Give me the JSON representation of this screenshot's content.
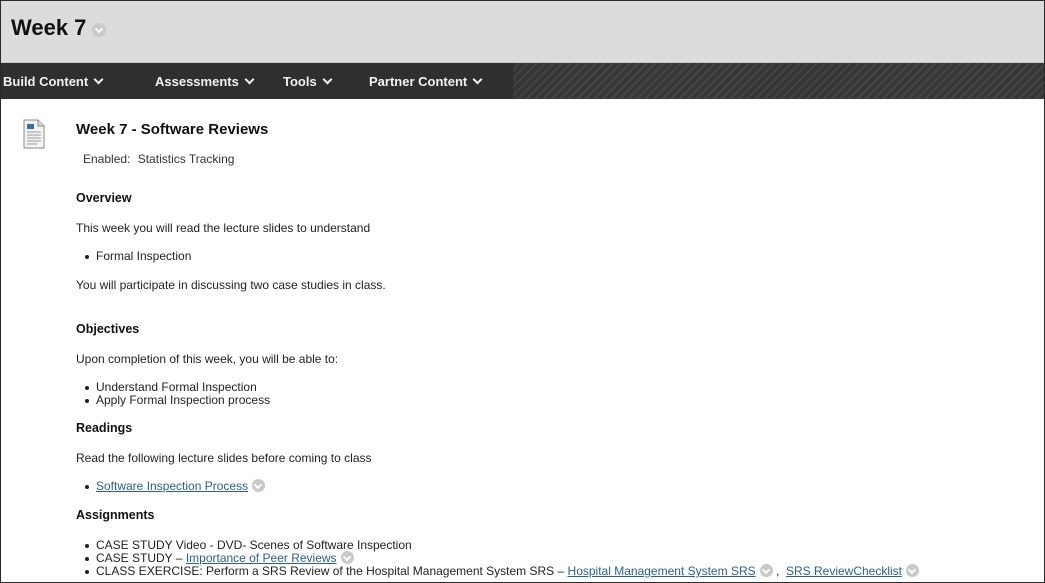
{
  "page": {
    "title": "Week 7"
  },
  "action_bar": {
    "menus": [
      {
        "label": "Build Content"
      },
      {
        "label": "Assessments"
      },
      {
        "label": "Tools"
      },
      {
        "label": "Partner Content"
      }
    ]
  },
  "content_item": {
    "title": "Week 7 - Software Reviews",
    "enabled_label": "Enabled:",
    "enabled_value": "Statistics Tracking",
    "overview": {
      "heading": "Overview",
      "intro": "This week you will read the lecture slides to understand",
      "bullets": [
        "Formal Inspection"
      ],
      "outro": "You will participate in discussing two case studies in class."
    },
    "objectives": {
      "heading": "Objectives",
      "intro": "Upon completion of this week, you will be able to:",
      "bullets": [
        "Understand Formal Inspection",
        "Apply Formal Inspection process"
      ]
    },
    "readings": {
      "heading": "Readings",
      "intro": "Read the following lecture slides before coming to class",
      "link": "Software Inspection Process"
    },
    "assignments": {
      "heading": "Assignments",
      "item1": "CASE STUDY Video - DVD- Scenes of Software Inspection",
      "item2_prefix": "CASE STUDY – ",
      "item2_link": "Importance of Peer Reviews",
      "item3_prefix": "CLASS EXERCISE: Perform a SRS Review of the Hospital Management System SRS – ",
      "item3_link1": "Hospital Management System SRS",
      "item3_sep": " ,  ",
      "item3_link2": "SRS ReviewChecklist"
    }
  }
}
